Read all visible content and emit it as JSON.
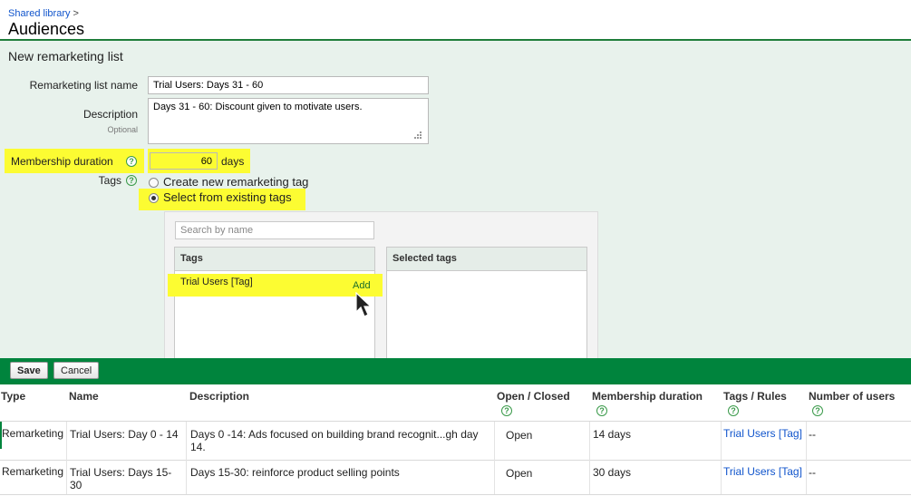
{
  "breadcrumb": {
    "link": "Shared library",
    "separator": ">"
  },
  "page_title": "Audiences",
  "form": {
    "heading": "New remarketing list",
    "name_label": "Remarketing list name",
    "name_value": "Trial Users: Days 31 - 60",
    "description_label": "Description",
    "description_optional": "Optional",
    "description_value": "Days 31 - 60: Discount given to motivate users.",
    "duration_label": "Membership duration",
    "duration_value": "60",
    "duration_unit": "days",
    "tags_label": "Tags",
    "radio_create": "Create new remarketing tag",
    "radio_select": "Select from existing tags",
    "help_glyph": "?"
  },
  "picker": {
    "search_placeholder": "Search by name",
    "tags_header": "Tags",
    "selected_header": "Selected tags",
    "tag_items": [
      {
        "label": "Trial Users [Tag]",
        "action": "Add"
      }
    ]
  },
  "actions": {
    "save": "Save",
    "cancel": "Cancel"
  },
  "table": {
    "headers": {
      "type": "Type",
      "name": "Name",
      "description": "Description",
      "open_closed": "Open / Closed",
      "membership_duration": "Membership duration",
      "tags_rules": "Tags / Rules",
      "number_of_users": "Number of users"
    },
    "rows": [
      {
        "type": "Remarketing",
        "name": "Trial Users: Day 0 - 14",
        "description": "Days 0 -14: Ads focused on building brand recognit...gh day 14.",
        "status": "Open",
        "duration": "14 days",
        "tags": "Trial Users [Tag]",
        "users": "--"
      },
      {
        "type": "Remarketing",
        "name": "Trial Users: Days 15-30",
        "description": "Days 15-30: reinforce product selling points",
        "status": "Open",
        "duration": "30 days",
        "tags": "Trial Users [Tag]",
        "users": "--"
      }
    ]
  },
  "colors": {
    "accent_green": "#00843d",
    "highlight_yellow": "#fcfc32",
    "panel_bg": "#e8f2ec",
    "link_blue": "#1155cc"
  },
  "icons": {
    "help": "help-icon",
    "cursor": "mouse-pointer-icon"
  }
}
